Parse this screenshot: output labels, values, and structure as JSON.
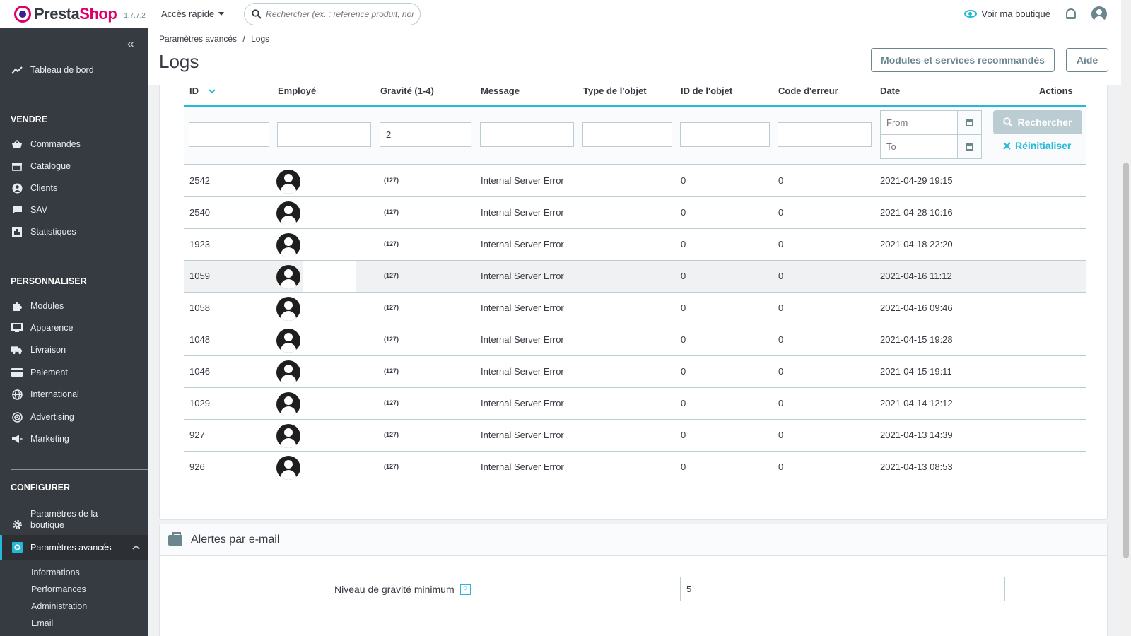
{
  "header": {
    "brand_presta": "Presta",
    "brand_shop": "Shop",
    "version": "1.7.7.2",
    "quick_access": "Accès rapide",
    "search_placeholder": "Rechercher (ex. : référence produit, nom",
    "view_shop": "Voir ma boutique",
    "accent_color": "#25b9d7"
  },
  "sidebar": {
    "collapse_icon": "«",
    "dashboard": "Tableau de bord",
    "sections": {
      "sell": "VENDRE",
      "customize": "PERSONNALISER",
      "configure": "CONFIGURER"
    },
    "sell_items": [
      "Commandes",
      "Catalogue",
      "Clients",
      "SAV",
      "Statistiques"
    ],
    "customize_items": [
      "Modules",
      "Apparence",
      "Livraison",
      "Paiement",
      "International",
      "Advertising",
      "Marketing"
    ],
    "configure_items": [
      "Paramètres de la boutique",
      "Paramètres avancés"
    ],
    "advanced_sub": [
      "Informations",
      "Performances",
      "Administration",
      "Email"
    ]
  },
  "page": {
    "breadcrumb_parent": "Paramètres avancés",
    "breadcrumb_sep": "/",
    "breadcrumb_current": "Logs",
    "title": "Logs",
    "btn_modules": "Modules et services recommandés",
    "btn_help": "Aide"
  },
  "table": {
    "columns": [
      "ID",
      "Employé",
      "Gravité (1-4)",
      "Message",
      "Type de l'objet",
      "ID de l'objet",
      "Code d'erreur",
      "Date",
      "Actions"
    ],
    "filter_severity": "2",
    "date_from_placeholder": "From",
    "date_to_placeholder": "To",
    "search_label": "Rechercher",
    "reset_label": "Réinitialiser",
    "rows": [
      {
        "id": "2542",
        "badge": "(127)",
        "message": "Internal Server Error",
        "object_id": "0",
        "error_code": "0",
        "date": "2021-04-29 19:15"
      },
      {
        "id": "2540",
        "badge": "(127)",
        "message": "Internal Server Error",
        "object_id": "0",
        "error_code": "0",
        "date": "2021-04-28 10:16"
      },
      {
        "id": "1923",
        "badge": "(127)",
        "message": "Internal Server Error",
        "object_id": "0",
        "error_code": "0",
        "date": "2021-04-18 22:20"
      },
      {
        "id": "1059",
        "badge": "(127)",
        "message": "Internal Server Error",
        "object_id": "0",
        "error_code": "0",
        "date": "2021-04-16 11:12"
      },
      {
        "id": "1058",
        "badge": "(127)",
        "message": "Internal Server Error",
        "object_id": "0",
        "error_code": "0",
        "date": "2021-04-16 09:46"
      },
      {
        "id": "1048",
        "badge": "(127)",
        "message": "Internal Server Error",
        "object_id": "0",
        "error_code": "0",
        "date": "2021-04-15 19:28"
      },
      {
        "id": "1046",
        "badge": "(127)",
        "message": "Internal Server Error",
        "object_id": "0",
        "error_code": "0",
        "date": "2021-04-15 19:11"
      },
      {
        "id": "1029",
        "badge": "(127)",
        "message": "Internal Server Error",
        "object_id": "0",
        "error_code": "0",
        "date": "2021-04-14 12:12"
      },
      {
        "id": "927",
        "badge": "(127)",
        "message": "Internal Server Error",
        "object_id": "0",
        "error_code": "0",
        "date": "2021-04-13 14:39"
      },
      {
        "id": "926",
        "badge": "(127)",
        "message": "Internal Server Error",
        "object_id": "0",
        "error_code": "0",
        "date": "2021-04-13 08:53"
      }
    ]
  },
  "alerts": {
    "title": "Alertes par e-mail",
    "min_severity_label": "Niveau de gravité minimum",
    "help_mark": "?",
    "min_severity_value": "5"
  }
}
